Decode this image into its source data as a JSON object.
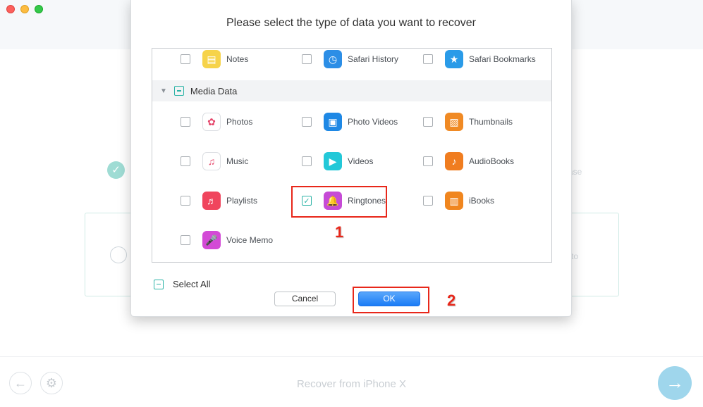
{
  "dialog": {
    "title": "Please select the type of data you want to recover",
    "top_row": [
      {
        "label": "Notes",
        "icon": "notes-icon",
        "color": "#f6d34a",
        "checked": false
      },
      {
        "label": "Safari History",
        "icon": "safari-history-icon",
        "color": "#2c8ee6",
        "checked": false
      },
      {
        "label": "Safari Bookmarks",
        "icon": "safari-bookmarks-icon",
        "color": "#2a9be8",
        "checked": false
      }
    ],
    "section": {
      "label": "Media Data",
      "state": "partial"
    },
    "media_rows": [
      [
        {
          "label": "Photos",
          "icon": "photos-icon",
          "color": "#ffffff",
          "checked": false
        },
        {
          "label": "Photo Videos",
          "icon": "photo-videos-icon",
          "color": "#1e88e5",
          "checked": false
        },
        {
          "label": "Thumbnails",
          "icon": "thumbnails-icon",
          "color": "#f08a24",
          "checked": false
        }
      ],
      [
        {
          "label": "Music",
          "icon": "music-icon",
          "color": "#ffffff",
          "checked": false
        },
        {
          "label": "Videos",
          "icon": "videos-icon",
          "color": "#23c8d8",
          "checked": false
        },
        {
          "label": "AudioBooks",
          "icon": "audiobooks-icon",
          "color": "#f07d20",
          "checked": false
        }
      ],
      [
        {
          "label": "Playlists",
          "icon": "playlists-icon",
          "color": "#f0455d",
          "checked": false
        },
        {
          "label": "Ringtones",
          "icon": "ringtones-icon",
          "color": "#c64bd6",
          "checked": true
        },
        {
          "label": "iBooks",
          "icon": "ibooks-icon",
          "color": "#f0861f",
          "checked": false
        }
      ],
      [
        {
          "label": "Voice Memo",
          "icon": "voice-memo-icon",
          "color": "#d34ad6",
          "checked": false
        }
      ]
    ],
    "select_all_label": "Select All",
    "cancel_label": "Cancel",
    "ok_label": "OK"
  },
  "annotations": {
    "step1": "1",
    "step2": "2"
  },
  "background": {
    "faint_right_1": "ase",
    "faint_right_2": "to",
    "footer_title": "Recover from iPhone X"
  },
  "colors": {
    "accent": "#2bb3a6",
    "highlight": "#e8271a",
    "ok_button": "#1b7cf6"
  }
}
